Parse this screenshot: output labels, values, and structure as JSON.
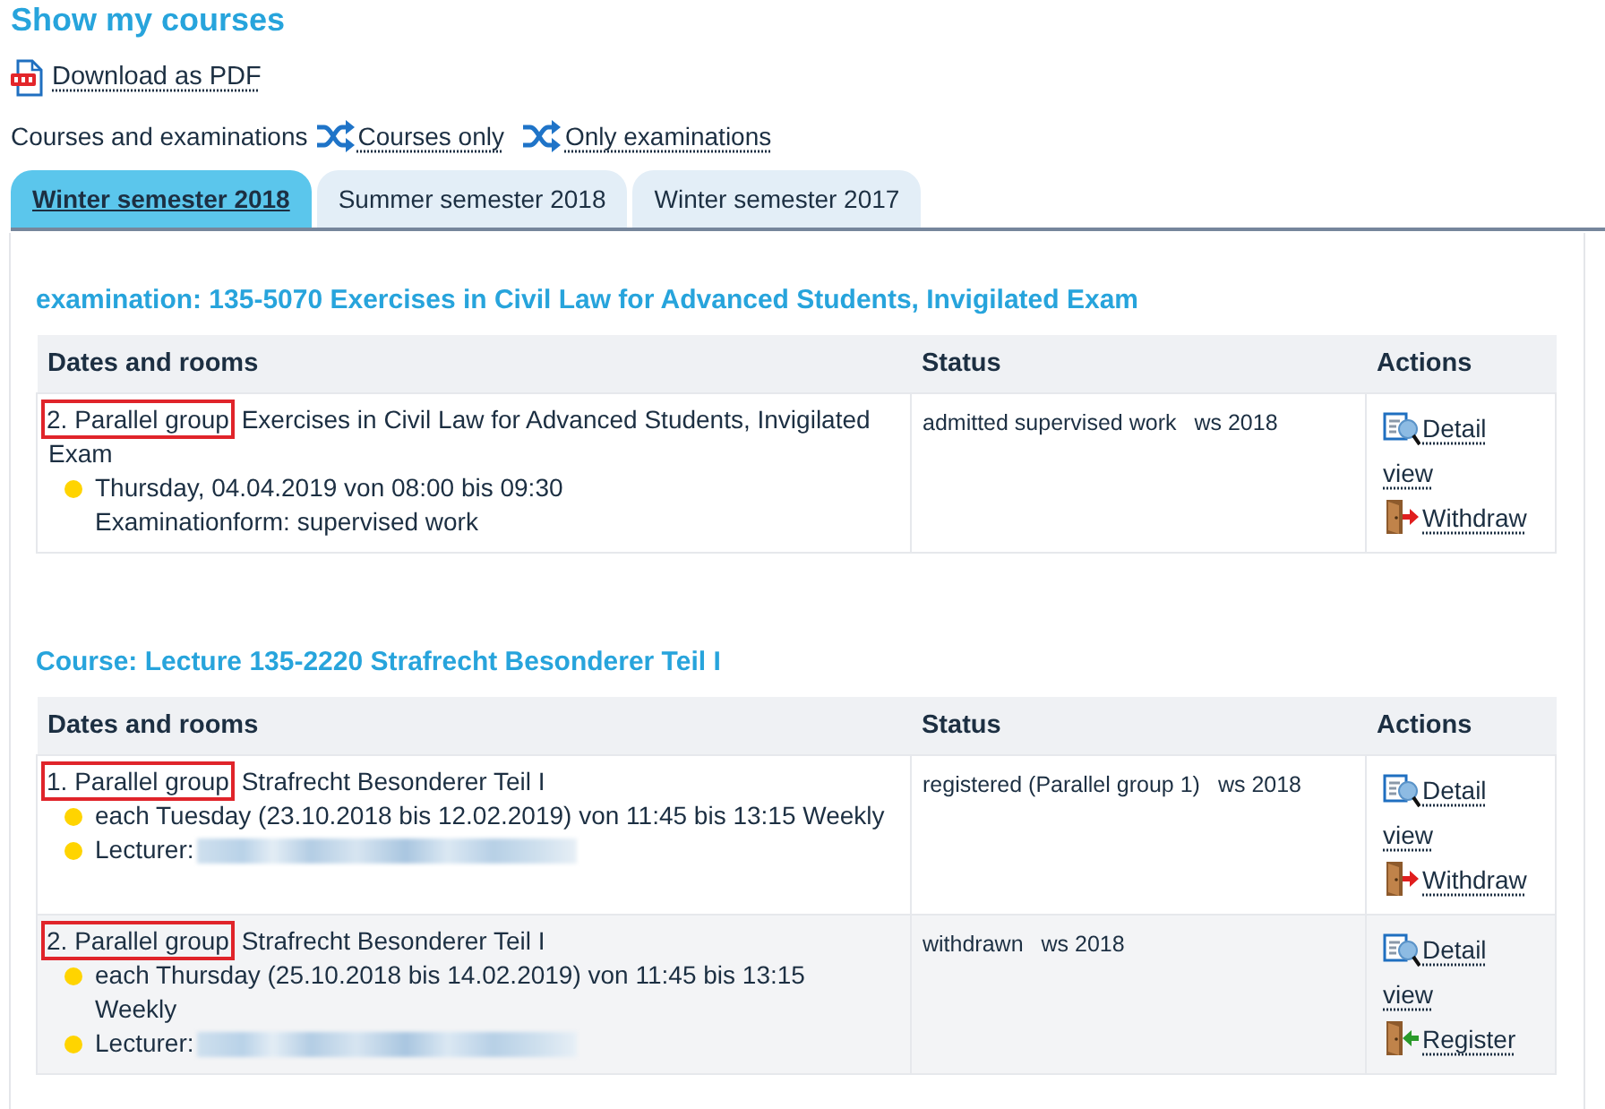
{
  "page": {
    "title": "Show my courses"
  },
  "download": {
    "label": "Download as PDF"
  },
  "view_filter": {
    "label": "Courses and examinations",
    "links": [
      {
        "label": "Courses only"
      },
      {
        "label": "Only examinations"
      }
    ]
  },
  "tabs": [
    {
      "label": "Winter semester 2018",
      "selected": true
    },
    {
      "label": "Summer semester 2018",
      "selected": false
    },
    {
      "label": "Winter semester 2017",
      "selected": false
    }
  ],
  "sections": [
    {
      "heading": "examination: 135-5070 Exercises in Civil Law for Advanced Students, Invigilated Exam",
      "columns": [
        "Dates and rooms",
        "Status",
        "Actions"
      ],
      "rows": [
        {
          "group": "2. Parallel group",
          "highlighted": true,
          "title": "Exercises in Civil Law for Advanced Students, Invigilated Exam",
          "details": [
            {
              "text": "Thursday, 04.04.2019 von 08:00 bis 09:30",
              "bullet": true,
              "redacted": false
            },
            {
              "text": "Examinationform: supervised work",
              "bullet": false,
              "redacted": false
            }
          ],
          "status": "admitted supervised work",
          "term": "ws 2018",
          "actions": [
            {
              "kind": "detail",
              "label": "Detail view"
            },
            {
              "kind": "withdraw",
              "label": "Withdraw"
            }
          ]
        }
      ]
    },
    {
      "heading": "Course: Lecture 135-2220 Strafrecht Besonderer Teil I",
      "columns": [
        "Dates and rooms",
        "Status",
        "Actions"
      ],
      "rows": [
        {
          "group": "1. Parallel group",
          "highlighted": true,
          "title": "Strafrecht Besonderer Teil I",
          "details": [
            {
              "text": "each Tuesday (23.10.2018 bis 12.02.2019) von 11:45 bis 13:15 Weekly",
              "bullet": true,
              "redacted": false
            },
            {
              "text": "Lecturer:",
              "bullet": true,
              "redacted": true
            }
          ],
          "status": "registered (Parallel group 1)",
          "term": "ws 2018",
          "actions": [
            {
              "kind": "detail",
              "label": "Detail view"
            },
            {
              "kind": "withdraw",
              "label": "Withdraw"
            }
          ]
        },
        {
          "group": "2. Parallel group",
          "highlighted": true,
          "title": "Strafrecht Besonderer Teil I",
          "details": [
            {
              "text": "each Thursday (25.10.2018 bis 14.02.2019) von 11:45 bis 13:15 Weekly",
              "bullet": true,
              "redacted": false
            },
            {
              "text": "Lecturer:",
              "bullet": true,
              "redacted": true
            }
          ],
          "status": "withdrawn",
          "term": "ws 2018",
          "actions": [
            {
              "kind": "detail",
              "label": "Detail view"
            },
            {
              "kind": "register",
              "label": "Register"
            }
          ]
        }
      ]
    }
  ]
}
